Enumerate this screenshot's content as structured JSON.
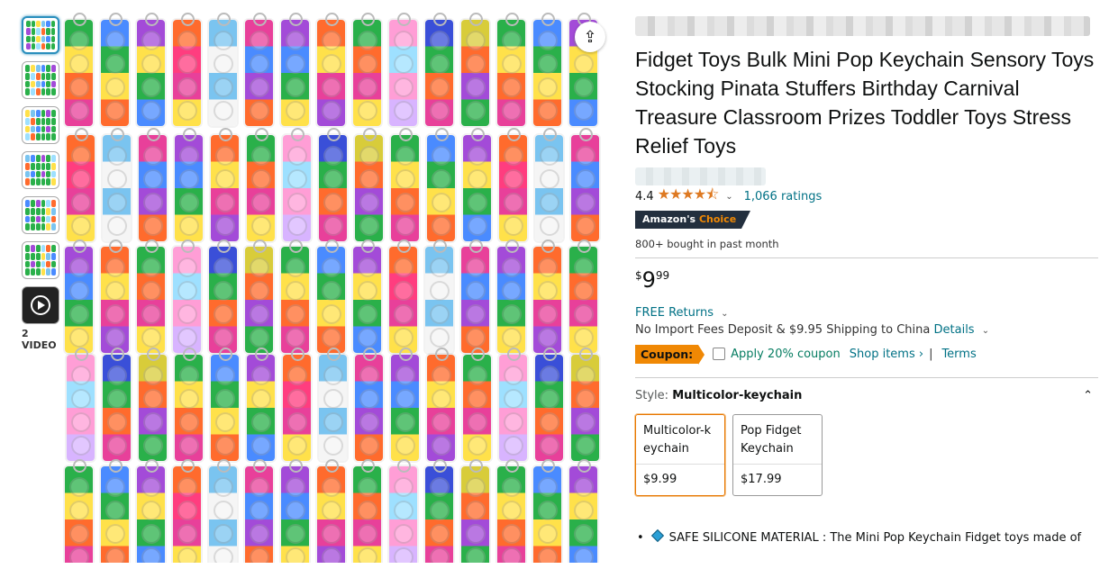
{
  "thumbnails": {
    "video_label": "2 VIDEO"
  },
  "product": {
    "title": "Fidget Toys Bulk Mini Pop Keychain Sensory Toys Stocking Pinata Stuffers Birthday Carnival Treasure Classroom Prizes Toddler Toys Stress Relief Toys",
    "rating_value": "4.4",
    "stars": "★★★★⯪",
    "ratings_count": "1,066 ratings",
    "badge_prefix": "Amazon's",
    "badge_choice": "Choice",
    "bought": "800+ bought in past month"
  },
  "price": {
    "symbol": "$",
    "whole": "9",
    "fraction": "99"
  },
  "shipping": {
    "returns": "FREE Returns",
    "import_text": "No Import Fees Deposit & $9.95 Shipping to China",
    "details": "Details"
  },
  "coupon": {
    "tag": "Coupon:",
    "apply": "Apply 20% coupon",
    "shop": "Shop items ›",
    "sep": "|",
    "terms": "Terms"
  },
  "style": {
    "label": "Style:",
    "value": "Multicolor-keychain",
    "options": [
      {
        "name": "Multicolor-keychain",
        "price": "$9.99"
      },
      {
        "name": "Pop Fidget Keychain",
        "price": "$17.99"
      }
    ]
  },
  "bullets": [
    "SAFE SILICONE MATERIAL : The Mini Pop Keychain Fidget toys made of"
  ],
  "colors": {
    "link": "#007185",
    "star": "#de7921",
    "coupon": "#f08804",
    "green": "#067d62"
  }
}
